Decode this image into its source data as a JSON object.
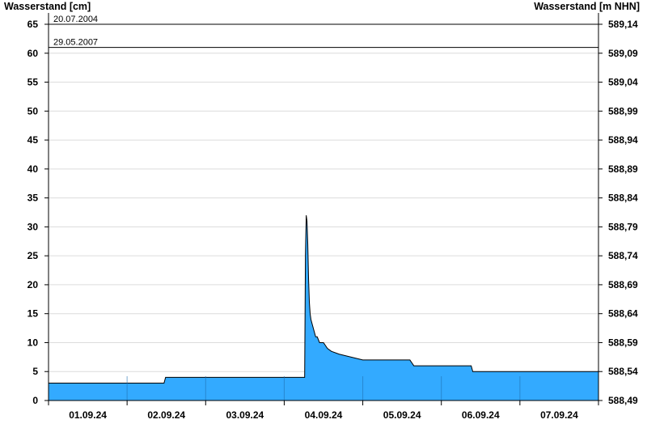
{
  "chart_data": {
    "type": "area",
    "ylabel_left": "Wasserstand [cm]",
    "ylabel_right": "Wasserstand [m NHN]",
    "ylim": [
      0,
      65
    ],
    "yticks": [
      0,
      5,
      10,
      15,
      20,
      25,
      30,
      35,
      40,
      45,
      50,
      55,
      60,
      65
    ],
    "yticks_right": [
      "588,49",
      "588,54",
      "588,59",
      "588,64",
      "588,69",
      "588,74",
      "588,79",
      "588,84",
      "588,89",
      "588,94",
      "588,99",
      "589,04",
      "589,09",
      "589,14"
    ],
    "xlim": [
      0,
      7
    ],
    "x_categories": [
      "01.09.24",
      "02.09.24",
      "03.09.24",
      "04.09.24",
      "05.09.24",
      "06.09.24",
      "07.09.24"
    ],
    "grid": true,
    "area_color": "#33aaff",
    "reference_lines": [
      {
        "label": "20.07.2004",
        "value": 65
      },
      {
        "label": "29.05.2007",
        "value": 61
      }
    ],
    "series": [
      {
        "x": [
          0.0,
          1.47,
          1.49,
          2.5,
          3.0,
          3.26,
          3.27,
          3.28,
          3.29,
          3.3,
          3.31,
          3.32,
          3.33,
          3.34,
          3.36,
          3.38,
          3.4,
          3.42,
          3.45,
          3.5,
          3.55,
          3.6,
          3.7,
          4.0,
          4.6,
          4.65,
          5.0,
          5.38,
          5.4,
          6.0,
          7.0
        ],
        "y": [
          3,
          3,
          4,
          4,
          4,
          4,
          25,
          32,
          31,
          27,
          21,
          17,
          15,
          14,
          13,
          12,
          11,
          11,
          10,
          10,
          9,
          8.5,
          8,
          7,
          7,
          6,
          6,
          6,
          5,
          5,
          5
        ]
      }
    ]
  }
}
